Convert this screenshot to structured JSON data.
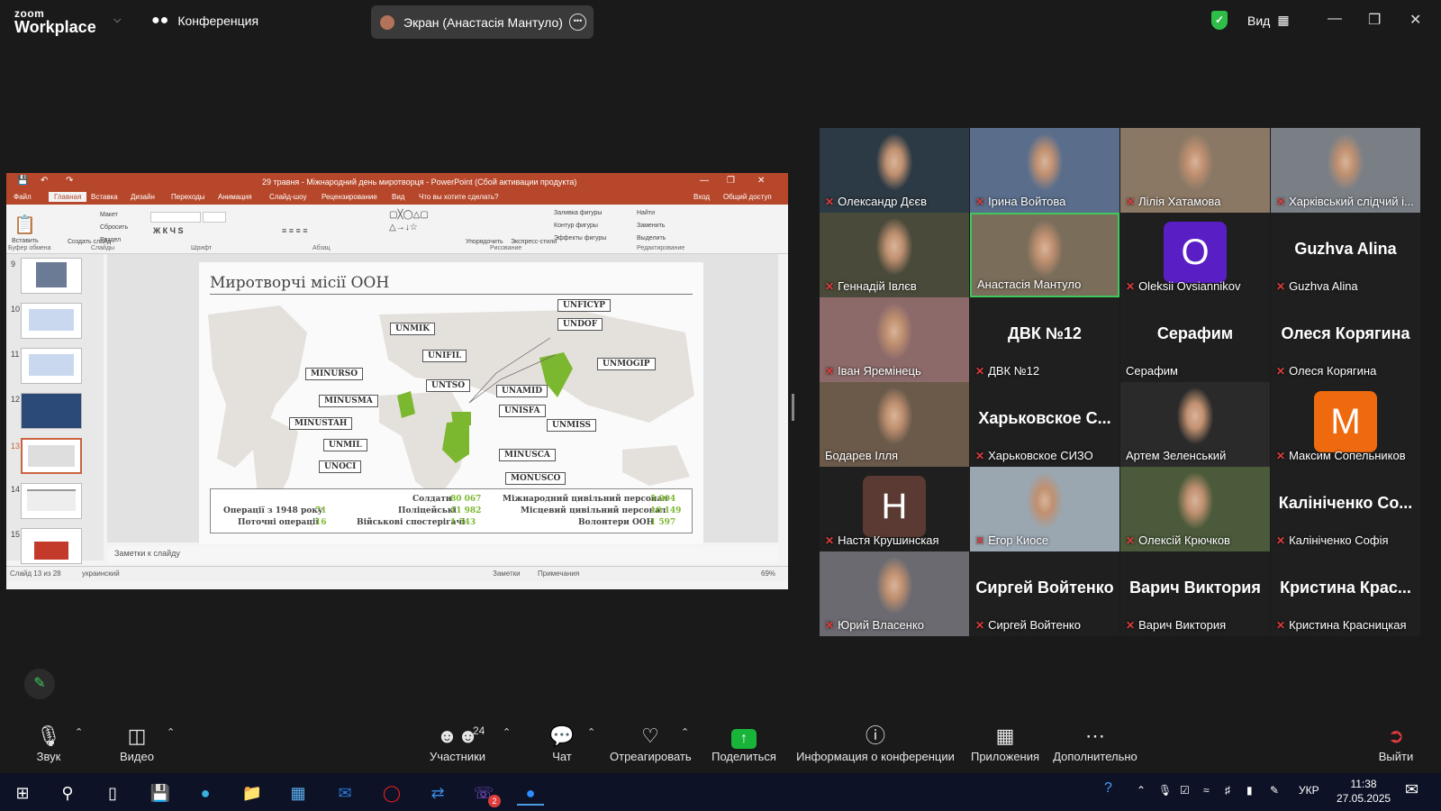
{
  "app": {
    "logo_top": "zoom",
    "logo_bottom": "Workplace",
    "conference_label": "Конференция",
    "screen_share_label": "Экран (Анастасія Мантуло)",
    "view_label": "Вид"
  },
  "ppt": {
    "window_title": "29 травня - Міжнародний день миротворця - PowerPoint (Сбой активации продукта)",
    "tabs": [
      "Файл",
      "Главная",
      "Вставка",
      "Дизайн",
      "Переходы",
      "Анимация",
      "Слайд-шоу",
      "Рецензирование",
      "Вид",
      "Что вы хотите сделать?"
    ],
    "login": "Вход",
    "share": "Общий доступ",
    "ribbon_groups": [
      "Буфер обмена",
      "Слайды",
      "Шрифт",
      "Абзац",
      "Рисование",
      "Редактирование"
    ],
    "ribbon_items": {
      "paste": "Вставить",
      "new_slide": "Создать слайд",
      "layout": "Макет",
      "reset": "Сбросить",
      "section": "Раздел",
      "arrange": "Упорядочить",
      "quick_styles": "Экспресс-стили",
      "fill": "Заливка фигуры",
      "outline": "Контур фигуры",
      "effects": "Эффекты фигуры",
      "find": "Найти",
      "replace": "Заменить",
      "select": "Выделить"
    },
    "slide_numbers": [
      "9",
      "10",
      "11",
      "12",
      "13",
      "14",
      "15"
    ],
    "notes_placeholder": "Заметки к слайду",
    "status": {
      "slide_counter": "Слайд 13 из 28",
      "language": "украинский",
      "notes": "Заметки",
      "comments": "Примечания",
      "zoom": "69%"
    }
  },
  "slide": {
    "title": "Миротворчі місії ООН",
    "missions": [
      "UNFICYP",
      "UNDOF",
      "UNMIK",
      "UNIFIL",
      "UNMOGIP",
      "MINURSO",
      "UNTSO",
      "UNAMID",
      "MINUSMA",
      "UNISFA",
      "UNMISS",
      "MINUSTAH",
      "UNMIL",
      "MINUSCA",
      "UNOCI",
      "MONUSCO"
    ],
    "stats": {
      "ops_since_1948_label": "Операції з 1948 року",
      "ops_since_1948_value": "71",
      "current_ops_label": "Поточні операції",
      "current_ops_value": "16",
      "soldiers_label": "Солдати",
      "soldiers_value": "80 067",
      "police_label": "Поліцейські",
      "police_value": "11 982",
      "observers_label": "Військові спостерігачі",
      "observers_value": "1 543",
      "intl_civil_label": "Міжнародний цивільний персонал",
      "intl_civil_value": "5 004",
      "local_civil_label": "Місцевий цивільний персонал",
      "local_civil_value": "10 149",
      "volunteers_label": "Волонтери ООН",
      "volunteers_value": "1 597"
    }
  },
  "participants": [
    {
      "name": "Олександр Дєєв",
      "muted": true,
      "type": "video",
      "color": "#2c3a45"
    },
    {
      "name": "Ірина Войтова",
      "muted": true,
      "type": "video",
      "color": "#5a6e8c"
    },
    {
      "name": "Лілія Хатамова",
      "muted": true,
      "type": "video",
      "color": "#8a7865"
    },
    {
      "name": "Харківський слідчий і...",
      "muted": true,
      "type": "video",
      "color": "#7a7f86"
    },
    {
      "name": "Геннадій Івлєв",
      "muted": true,
      "type": "video",
      "color": "#4a4a3a"
    },
    {
      "name": "Анастасія Мантуло",
      "muted": false,
      "type": "video",
      "color": "#7a6d5a",
      "active": true
    },
    {
      "name": "Oleksii Ovsiannikov",
      "muted": true,
      "type": "avatar",
      "letter": "O",
      "color": "#5a1fc4"
    },
    {
      "name": "Guzhva Alina",
      "muted": true,
      "type": "text",
      "big": "Guzhva Alina"
    },
    {
      "name": "Іван Яремінець",
      "muted": true,
      "type": "video",
      "color": "#8c6a6a"
    },
    {
      "name": "ДВК №12",
      "muted": true,
      "type": "text",
      "big": "ДВК №12"
    },
    {
      "name": "Серафим",
      "muted": false,
      "type": "text",
      "big": "Серафим"
    },
    {
      "name": "Олеся Корягина",
      "muted": true,
      "type": "text",
      "big": "Олеся Корягина"
    },
    {
      "name": "Бодарев Ілля",
      "muted": false,
      "type": "video",
      "color": "#6b5a4a"
    },
    {
      "name": "Харьковское СИЗО",
      "muted": true,
      "type": "text",
      "big": "Харьковское С..."
    },
    {
      "name": "Артем Зеленський",
      "muted": false,
      "type": "video",
      "color": "#2a2a2a"
    },
    {
      "name": "Максим Сопельников",
      "muted": true,
      "type": "avatar",
      "letter": "M",
      "color": "#ef6a0f"
    },
    {
      "name": "Настя Крушинская",
      "muted": true,
      "type": "avatar",
      "letter": "H",
      "color": "#5a3a32"
    },
    {
      "name": "Егор Киосе",
      "muted": true,
      "type": "video",
      "color": "#9aa6b0"
    },
    {
      "name": "Олексій Крючков",
      "muted": true,
      "type": "video",
      "color": "#4a5a3a"
    },
    {
      "name": "Калініченко Софія",
      "muted": true,
      "type": "text",
      "big": "Калініченко Со..."
    },
    {
      "name": "Юрий Власенко",
      "muted": true,
      "type": "video",
      "color": "#6a6a70"
    },
    {
      "name": "Сиргей Войтенко",
      "muted": true,
      "type": "text",
      "big": "Сиргей Войтенко"
    },
    {
      "name": "Варич Виктория",
      "muted": true,
      "type": "text",
      "big": "Варич Виктория"
    },
    {
      "name": "Кристина Красницкая",
      "muted": true,
      "type": "text",
      "big": "Кристина Крас..."
    }
  ],
  "toolbar": {
    "audio": "Звук",
    "video": "Видео",
    "participants": "Участники",
    "participants_count": "24",
    "chat": "Чат",
    "react": "Отреагировать",
    "share": "Поделиться",
    "info": "Информация о конференции",
    "apps": "Приложения",
    "more": "Дополнительно",
    "leave": "Выйти"
  },
  "taskbar": {
    "lang": "УКР",
    "time": "11:38",
    "date": "27.05.2025",
    "viber_badge": "2"
  },
  "colors": {
    "zoom_green": "#3fc85b",
    "share_green": "#19b53a",
    "ppt_red": "#b7472a",
    "map_green": "#7cb82f",
    "mute_red": "#e03c3c"
  }
}
